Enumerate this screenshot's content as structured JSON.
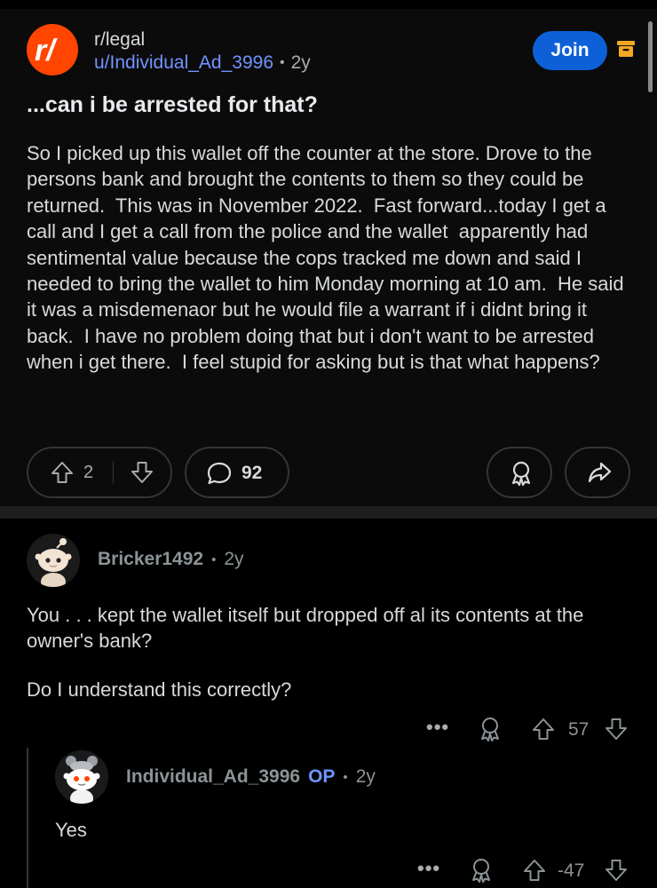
{
  "post": {
    "subreddit": "r/legal",
    "author": "u/Individual_Ad_3996",
    "age": "2y",
    "join_label": "Join",
    "title": "...can i be arrested for that?",
    "body": "So I picked up this wallet off the counter at the store. Drove to the persons bank and brought the contents to them so they could be returned.  This was in November 2022.  Fast forward...today I get a call and I get a call from the police and the wallet  apparently had sentimental value because the cops tracked me down and said I needed to bring the wallet to him Monday morning at 10 am.  He said it was a misdemenaor but he would file a warrant if i didnt bring it back.  I have no problem doing that but i don't want to be arrested when i get there.  I feel stupid for asking but is that what happens?",
    "votes": "2",
    "comments": "92"
  },
  "comments": [
    {
      "username": "Bricker1492",
      "age": "2y",
      "body": [
        "You . . . kept the wallet itself but dropped off al its contents at the owner's bank?",
        "Do I understand this correctly?"
      ],
      "votes": "57"
    },
    {
      "username": "Individual_Ad_3996",
      "op_label": "OP",
      "age": "2y",
      "body": "Yes",
      "votes": "-47"
    }
  ],
  "ui": {
    "separator_dot": "•",
    "more_label": "•••"
  },
  "icons": {
    "subreddit": "reddit-r-slash-logo",
    "archive": "archive-box-icon",
    "upvote": "arrow-up-icon",
    "downvote": "arrow-down-icon",
    "comment": "speech-bubble-icon",
    "award": "award-ribbon-icon",
    "share": "share-arrow-icon",
    "more": "more-dots-icon"
  },
  "colors": {
    "background": "#0b0b0b",
    "accent_blue": "#0d60d8",
    "link_blue": "#7193ff",
    "subreddit_orange": "#ff4500",
    "archive_orange": "#f5a623"
  }
}
